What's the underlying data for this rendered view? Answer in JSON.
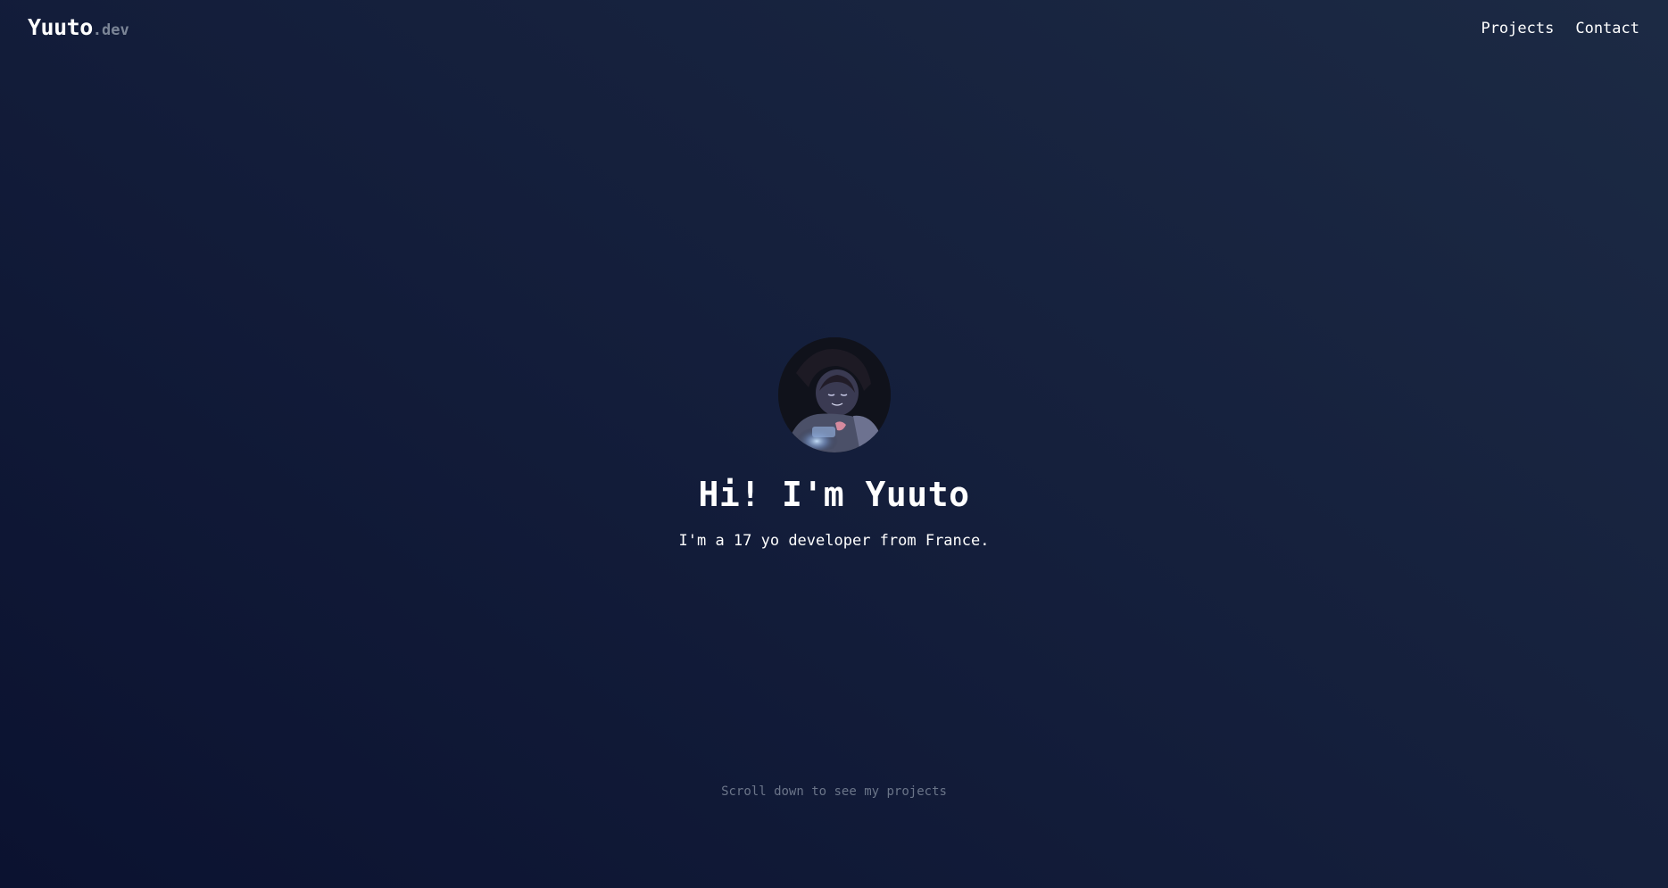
{
  "header": {
    "logo_main": "Yuuto",
    "logo_suffix": ".dev",
    "nav": [
      {
        "label": "Projects"
      },
      {
        "label": "Contact"
      }
    ]
  },
  "hero": {
    "avatar_icon": "avatar-image",
    "title": "Hi! I'm Yuuto",
    "subtitle": "I'm a 17 yo developer from France."
  },
  "footer": {
    "scroll_hint": "Scroll down to see my projects"
  },
  "colors": {
    "background_start": "#0b1230",
    "background_end": "#1c2a44",
    "text": "#ffffff",
    "muted_text": "#6b7589",
    "logo_suffix": "#7b8596"
  }
}
